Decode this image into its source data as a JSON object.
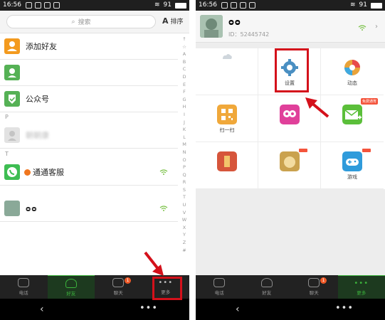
{
  "status": {
    "time": "16:56",
    "battery": "91"
  },
  "left": {
    "search_placeholder": "搜索",
    "sort_label": "排序",
    "contacts": [
      {
        "name": "添加好友",
        "color": "#f39a1e"
      },
      {
        "name": "",
        "color": "#55b155"
      },
      {
        "name": "公众号",
        "color": "#55b155"
      }
    ],
    "section_p": "P",
    "blurred_contact": "朝朝康",
    "section_t": "T",
    "tongtong": "通通客服",
    "alpha_index": [
      "↑",
      "☆",
      "A",
      "B",
      "C",
      "D",
      "E",
      "F",
      "G",
      "H",
      "I",
      "J",
      "K",
      "L",
      "M",
      "N",
      "O",
      "P",
      "Q",
      "R",
      "S",
      "T",
      "U",
      "V",
      "W",
      "X",
      "Y",
      "Z",
      "#"
    ]
  },
  "nav": {
    "items": [
      "电话",
      "好友",
      "聊天",
      "更多"
    ],
    "chat_badge": "1"
  },
  "right": {
    "profile_name": "ᴑᴑ",
    "profile_id": "ID：52445742",
    "grid": [
      {
        "label": "",
        "color": "#cfd6dc"
      },
      {
        "label": "设置",
        "color": "#4a8fc2"
      },
      {
        "label": "动态",
        "color": "#e9a33a"
      },
      {
        "label": "扫一扫",
        "color": "#f0a83a"
      },
      {
        "label": "",
        "color": "#e0409a"
      },
      {
        "label": "",
        "color": "#5bbf3a"
      },
      {
        "label": "",
        "color": "#d6553b"
      },
      {
        "label": "",
        "color": "#caa24e"
      },
      {
        "label": "游戏",
        "color": "#2f9bdb"
      }
    ],
    "top_right_badge": "免费通宵"
  },
  "colors": {
    "accent_green": "#3cb43c",
    "highlight_red": "#d4111b"
  }
}
